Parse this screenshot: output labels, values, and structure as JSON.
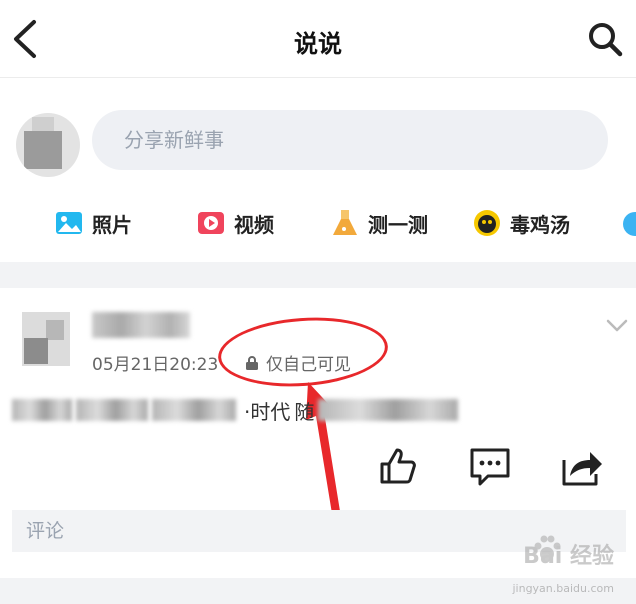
{
  "header": {
    "title": "说说",
    "back_icon": "chevron-left-icon",
    "search_icon": "search-icon"
  },
  "composer": {
    "placeholder": "分享新鲜事",
    "shortcuts": [
      {
        "label": "照片",
        "icon": "photo-icon",
        "color": "#22b8ef"
      },
      {
        "label": "视频",
        "icon": "video-icon",
        "color": "#f0445c"
      },
      {
        "label": "测一测",
        "icon": "flask-icon",
        "color": "#f2a93b"
      },
      {
        "label": "毒鸡汤",
        "icon": "soup-icon",
        "color": "#f6c800"
      }
    ]
  },
  "post": {
    "time": "05月21日20:23",
    "privacy": "仅自己可见",
    "content_visible_text": "·时代",
    "content_visible_text2": "随",
    "more_icon": "chevron-down-icon",
    "actions": [
      {
        "name": "like",
        "icon": "thumbs-up-icon"
      },
      {
        "name": "comment",
        "icon": "comment-icon"
      },
      {
        "name": "share",
        "icon": "share-icon"
      }
    ],
    "comment_placeholder": "评论"
  },
  "annotation": {
    "color": "#e8282b"
  },
  "watermark": {
    "brand": "Bai 经验",
    "site": "jingyan.baidu.com"
  }
}
